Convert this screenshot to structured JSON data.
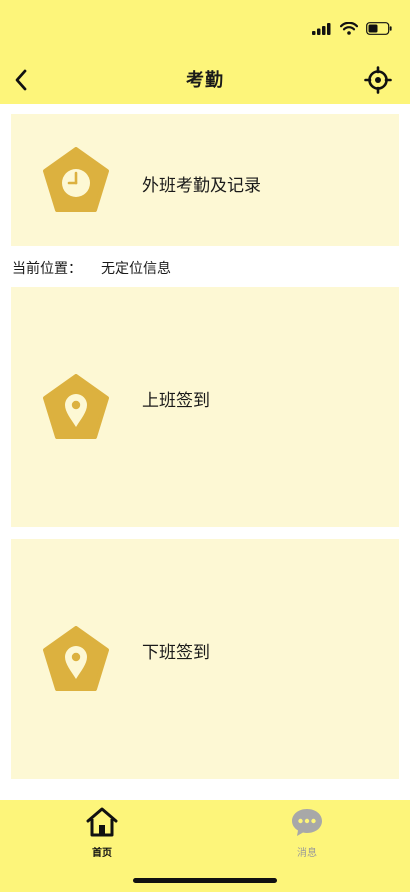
{
  "status_bar": {
    "icons": [
      "signal-icon",
      "wifi-icon",
      "battery-icon"
    ]
  },
  "header": {
    "title": "考勤",
    "back_icon": "chevron-left-icon",
    "action_icon": "crosshair-icon"
  },
  "cards": [
    {
      "label": "外班考勤及记录",
      "icon": "clock-icon"
    },
    {
      "label": "上班签到",
      "icon": "map-pin-icon"
    },
    {
      "label": "下班签到",
      "icon": "map-pin-icon"
    }
  ],
  "location": {
    "label": "当前位置：",
    "value": "无定位信息"
  },
  "tab_bar": {
    "tabs": [
      {
        "label": "首页",
        "icon": "home-icon",
        "active": true
      },
      {
        "label": "消息",
        "icon": "chat-bubble-icon",
        "active": false
      }
    ]
  },
  "colors": {
    "header_bg": "#fdf57a",
    "card_bg": "#fdf8d4",
    "badge": "#dcb13f",
    "tab_inactive": "#9a9a9a"
  }
}
